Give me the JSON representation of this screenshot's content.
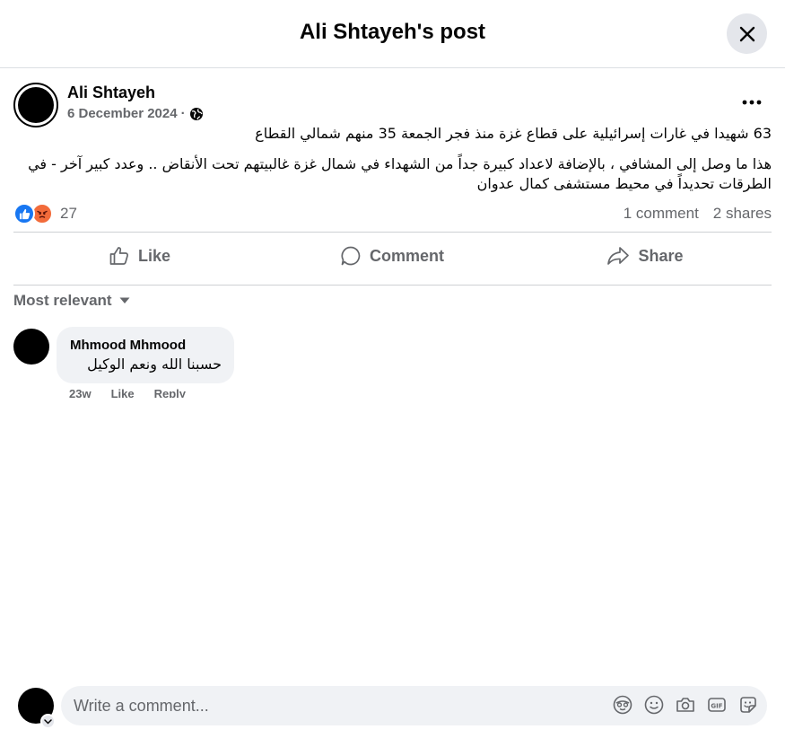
{
  "header": {
    "title": "Ali Shtayeh's post",
    "close_icon": "close-icon"
  },
  "post": {
    "author": "Ali Shtayeh",
    "date": "6 December 2024",
    "separator": "·",
    "audience_icon": "globe-icon",
    "more_icon": "more-dots-icon",
    "text_line1": "63 شهيدا في غارات إسرائيلية على قطاع غزة منذ فجر الجمعة 35 منهم شمالي القطاع",
    "text_para2": "هذا ما وصل إلى المشافي ، بالإضافة لاعداد كبيرة جداً من الشهداء في شمال غزة غالبيتهم تحت الأنقاض .. وعدد كبير آخر - في الطرقات تحديداً في محيط مستشفى كمال عدوان"
  },
  "reactions": {
    "types": [
      "like",
      "angry"
    ],
    "count": "27",
    "comments": "1 comment",
    "shares": "2 shares",
    "colors": {
      "like": "#1877f2",
      "angry": "#f26b3a"
    }
  },
  "actions": {
    "like": "Like",
    "comment": "Comment",
    "share": "Share"
  },
  "sort": {
    "label": "Most relevant"
  },
  "comments": [
    {
      "author": "Mhmood Mhmood",
      "text": "حسبنا الله ونعم الوكيل",
      "time": "23w",
      "like": "Like",
      "reply": "Reply"
    }
  ],
  "composer": {
    "placeholder": "Write a comment...",
    "icons": [
      "avatar-sticker-icon",
      "emoji-icon",
      "camera-icon",
      "gif-icon",
      "sticker-icon"
    ]
  }
}
